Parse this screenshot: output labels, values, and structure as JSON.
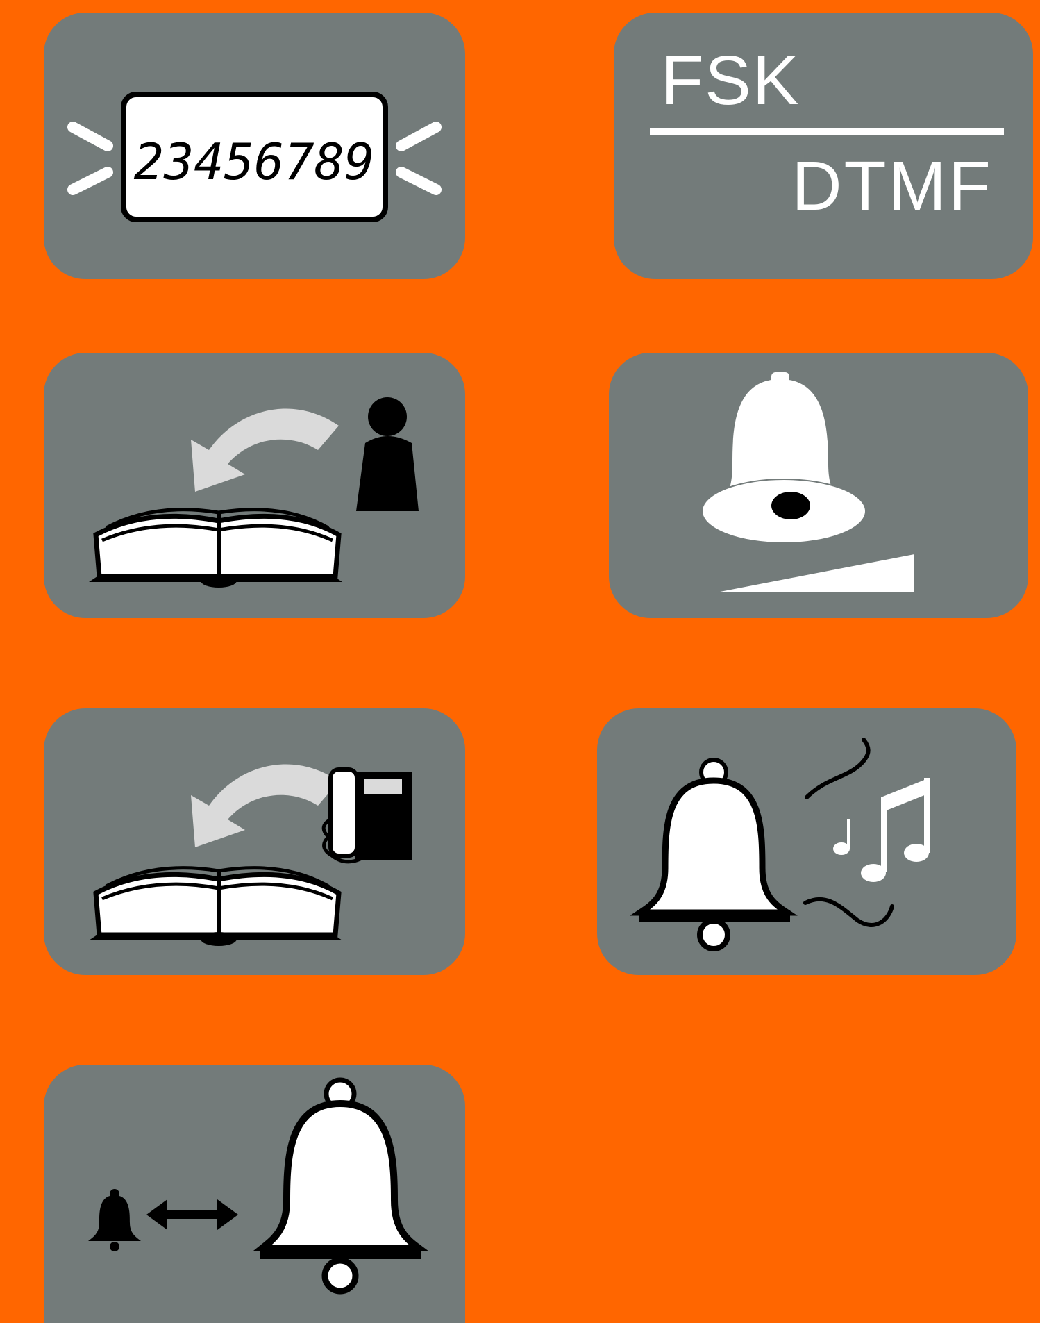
{
  "colors": {
    "background": "#FF6600",
    "tile": "#737B7A",
    "icon_white": "#FFFFFF",
    "icon_black": "#000000",
    "arrow_light": "#DADADA"
  },
  "tiles": {
    "caller_id_display": {
      "icon": "lcd-display-icon",
      "digits": "23456789"
    },
    "fsk_dtmf": {
      "top_label": "FSK",
      "bottom_label": "DTMF"
    },
    "phonebook_contact": {
      "icon": "book-person-icon"
    },
    "ringer_volume": {
      "icon": "bell-volume-icon"
    },
    "phonebook_phone": {
      "icon": "book-phone-icon"
    },
    "ring_melody": {
      "icon": "bell-melody-icon"
    },
    "ring_switch": {
      "icon": "bell-switch-icon"
    }
  }
}
